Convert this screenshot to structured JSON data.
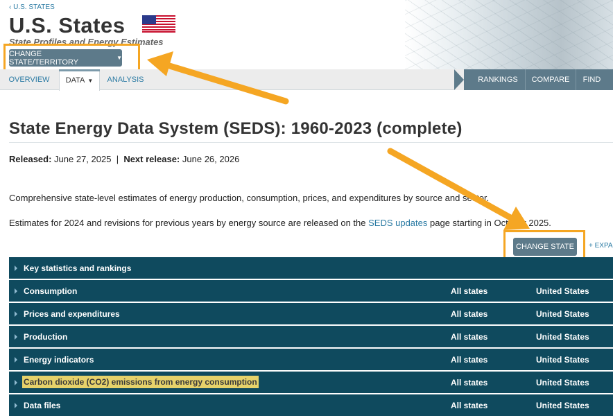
{
  "header": {
    "breadcrumb": "‹ U.S. STATES",
    "site_title": "U.S. States",
    "site_subtitle": "State Profiles and Energy Estimates",
    "flag_icon": "us-flag-icon",
    "change_territory_label": "CHANGE STATE/TERRITORY",
    "tabs": [
      {
        "label": "OVERVIEW"
      },
      {
        "label": "DATA"
      },
      {
        "label": "ANALYSIS"
      }
    ],
    "right_nav": [
      {
        "label": "RANKINGS"
      },
      {
        "label": "COMPARE"
      },
      {
        "label": "FIND"
      }
    ]
  },
  "main": {
    "title": "State Energy Data System (SEDS): 1960-2023 (complete)",
    "released_label": "Released:",
    "released_date": "June 27, 2025",
    "separator": "|",
    "next_release_label": "Next release:",
    "next_release_date": "June 26, 2026",
    "description_1": "Comprehensive state-level estimates of energy production, consumption, prices, and expenditures by source and sector.",
    "description_2_pre": "Estimates for 2024 and revisions for previous years by energy source are released on the ",
    "description_2_link": "SEDS updates",
    "description_2_post": " page starting in October 2025.",
    "change_state_label": "CHANGE STATE",
    "expand_label": "+ EXPAND ALL"
  },
  "accordion": [
    {
      "label": "Key statistics and rankings",
      "col1": "",
      "col2": ""
    },
    {
      "label": "Consumption",
      "col1": "All states",
      "col2": "United States"
    },
    {
      "label": "Prices and expenditures",
      "col1": "All states",
      "col2": "United States"
    },
    {
      "label": "Production",
      "col1": "All states",
      "col2": "United States"
    },
    {
      "label": "Energy indicators",
      "col1": "All states",
      "col2": "United States"
    },
    {
      "label": "Carbon dioxide (CO2) emissions from energy consumption",
      "col1": "All states",
      "col2": "United States",
      "highlighted": true
    },
    {
      "label": "Data files",
      "col1": "All states",
      "col2": "United States"
    }
  ],
  "colors": {
    "accent": "#5d7a8a",
    "accordion_bg": "#0f4a5e",
    "link": "#2a7aa3",
    "annotation": "#f5a623",
    "highlight": "#e6d26a"
  }
}
